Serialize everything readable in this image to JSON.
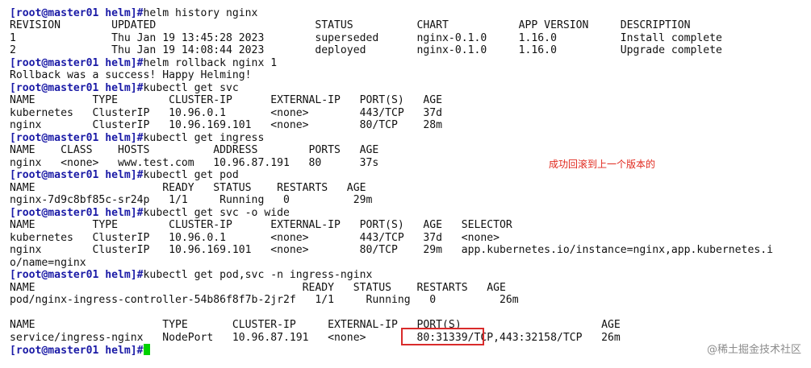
{
  "terminal": {
    "prompt": "[root@master01 helm]#",
    "blocks": [
      {
        "command": "helm history nginx",
        "output": [
          "REVISION        UPDATED                         STATUS          CHART           APP VERSION     DESCRIPTION",
          "1               Thu Jan 19 13:45:28 2023        superseded      nginx-0.1.0     1.16.0          Install complete",
          "2               Thu Jan 19 14:08:44 2023        deployed        nginx-0.1.0     1.16.0          Upgrade complete"
        ]
      },
      {
        "command": "helm rollback nginx 1",
        "output": [
          "Rollback was a success! Happy Helming!"
        ]
      },
      {
        "command": "kubectl get svc",
        "output": [
          "NAME         TYPE        CLUSTER-IP      EXTERNAL-IP   PORT(S)   AGE",
          "kubernetes   ClusterIP   10.96.0.1       <none>        443/TCP   37d",
          "nginx        ClusterIP   10.96.169.101   <none>        80/TCP    28m"
        ]
      },
      {
        "command": "kubectl get ingress",
        "output": [
          "NAME    CLASS    HOSTS          ADDRESS        PORTS   AGE",
          "nginx   <none>   www.test.com   10.96.87.191   80      37s"
        ]
      },
      {
        "command": "kubectl get pod",
        "output": [
          "NAME                    READY   STATUS    RESTARTS   AGE",
          "nginx-7d9c8bf85c-sr24p   1/1     Running   0          29m"
        ]
      },
      {
        "command": "kubectl get svc -o wide",
        "output": [
          "NAME         TYPE        CLUSTER-IP      EXTERNAL-IP   PORT(S)   AGE   SELECTOR",
          "kubernetes   ClusterIP   10.96.0.1       <none>        443/TCP   37d   <none>",
          "nginx        ClusterIP   10.96.169.101   <none>        80/TCP    29m   app.kubernetes.io/instance=nginx,app.kubernetes.i",
          "o/name=nginx"
        ]
      },
      {
        "command": "kubectl get pod,svc -n ingress-nginx",
        "output": [
          "NAME                                          READY   STATUS    RESTARTS   AGE",
          "pod/nginx-ingress-controller-54b86f8f7b-2jr2f   1/1     Running   0          26m",
          "",
          "NAME                    TYPE       CLUSTER-IP     EXTERNAL-IP   PORT(S)                      AGE",
          "service/ingress-nginx   NodePort   10.96.87.191   <none>        80:31339/TCP,443:32158/TCP   26m"
        ]
      },
      {
        "command": "",
        "output": []
      }
    ]
  },
  "annotation": "成功回滚到上一个版本的",
  "watermark": "@稀土掘金技术社区",
  "colors": {
    "prompt": "#1a1aa6",
    "annotation": "#e0281d",
    "highlight_box": "#d92b2b",
    "cursor": "#00d200"
  }
}
